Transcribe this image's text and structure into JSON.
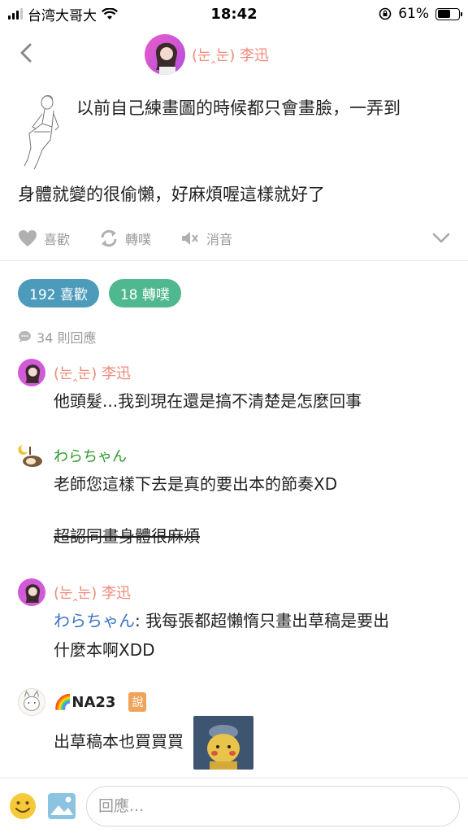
{
  "status_bar": {
    "carrier": "台湾大哥大",
    "time": "18:42",
    "battery_percent": "61%",
    "battery_level": 0.61,
    "icons": [
      "signal-icon",
      "wifi-icon",
      "rotation-lock-icon",
      "battery-icon"
    ]
  },
  "header": {
    "author_name": "(눈‸눈) 李迅",
    "back_icon": "chevron-left-icon"
  },
  "post": {
    "line1": "以前自己練畫圖的時候都只會畫臉，一弄到",
    "line2": "身體就變的很偷懶，好麻煩喔這樣就好了",
    "actions": {
      "like": "喜歡",
      "replurk": "轉噗",
      "mute": "消音"
    }
  },
  "stats": {
    "likes": "192 喜歡",
    "replurks": "18 轉噗",
    "responses": "34 則回應"
  },
  "comments": [
    {
      "name": "(눈‸눈) 李迅",
      "text": "他頭髮...我到現在還是搞不清楚是怎麼回事"
    },
    {
      "name": "わらちゃん",
      "text1": "老師您這樣下去是真的要出本的節奏XD",
      "text2": "超認同畫身體很麻煩"
    },
    {
      "name": "(눈‸눈) 李迅",
      "mention": "わらちゃん",
      "text": ": 我每張都超懶惰只畫出草稿是要出",
      "text_cont": "什麼本啊XDD"
    },
    {
      "name": "🌈NA23",
      "badge": "說",
      "text": "出草稿本也買買買"
    }
  ],
  "reply": {
    "placeholder": "回應..."
  },
  "colors": {
    "author_pink": "#f08a7a",
    "green_name": "#2f9a2a",
    "like_pill": "#4d9bba",
    "replurk_pill": "#4fb88e",
    "mention_blue": "#3d73c8",
    "badge_orange": "#f0a35a"
  }
}
